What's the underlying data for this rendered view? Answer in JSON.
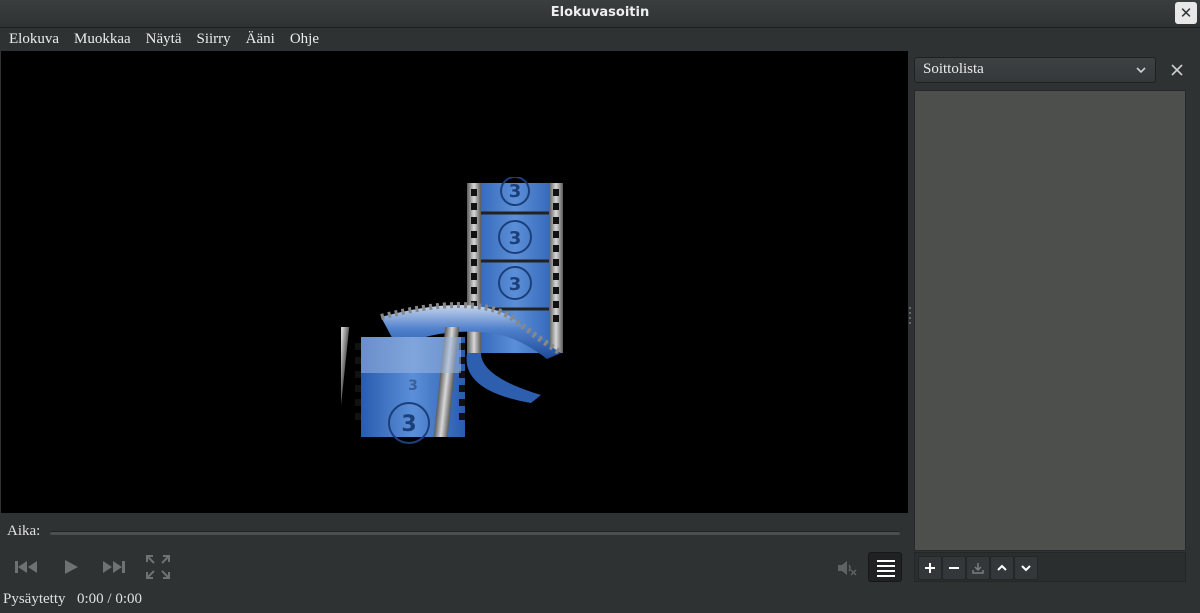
{
  "window": {
    "title": "Elokuvasoitin",
    "close_glyph": "✕"
  },
  "menu": [
    {
      "label": "Elokuva"
    },
    {
      "label": "Muokkaa"
    },
    {
      "label": "Näytä"
    },
    {
      "label": "Siirry"
    },
    {
      "label": "Ääni"
    },
    {
      "label": "Ohje"
    }
  ],
  "video": {
    "logo_icon": "film-reel-logo",
    "background": "#000000",
    "accent": "#3a6fc0"
  },
  "seek": {
    "label": "Aika:",
    "progress": 0
  },
  "controls": {
    "previous_icon": "skip-backward-icon",
    "play_icon": "play-icon",
    "next_icon": "skip-forward-icon",
    "fullscreen_icon": "fullscreen-icon",
    "volume_icon": "volume-muted-icon",
    "playlist_icon": "playlist-toggle-icon"
  },
  "status": {
    "state": "Pysäytetty",
    "time": "0:00 / 0:00"
  },
  "sidebar": {
    "selected": "Soittolista",
    "close_icon": "close-icon",
    "items": [],
    "toolbar": [
      "add-icon",
      "remove-icon",
      "save-icon",
      "move-up-icon",
      "move-down-icon"
    ]
  }
}
